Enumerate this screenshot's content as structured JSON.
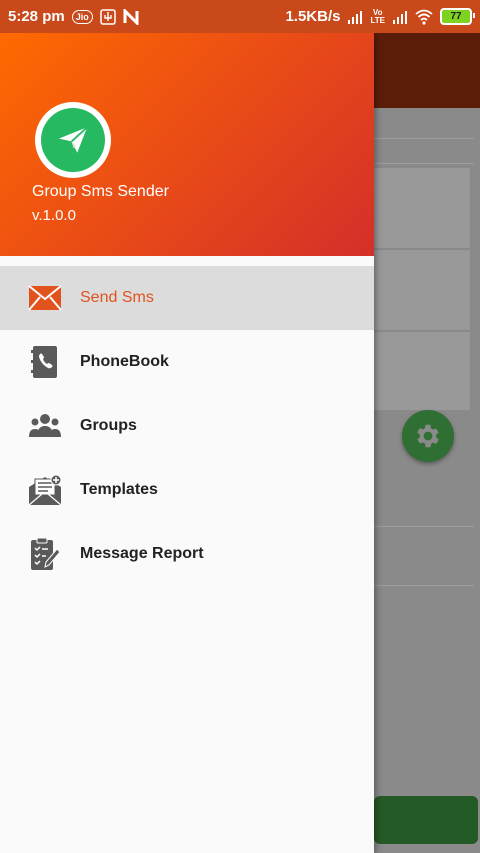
{
  "status_bar": {
    "time": "5:28 pm",
    "carrier_badge": "Jio",
    "speed": "1.5KB/s",
    "volte_top": "Vo",
    "volte_bottom": "LTE",
    "battery": "77"
  },
  "drawer": {
    "app_name": "Group Sms Sender",
    "version": "v.1.0.0",
    "items": [
      {
        "label": "Send Sms",
        "icon": "envelope-icon",
        "active": true
      },
      {
        "label": "PhoneBook",
        "icon": "phonebook-icon",
        "active": false
      },
      {
        "label": "Groups",
        "icon": "groups-icon",
        "active": false
      },
      {
        "label": "Templates",
        "icon": "templates-icon",
        "active": false
      },
      {
        "label": "Message Report",
        "icon": "report-icon",
        "active": false
      }
    ]
  },
  "colors": {
    "accent": "#e2521d",
    "header_start": "#ff6a00",
    "header_end": "#d42f2a",
    "logo_green": "#27b862",
    "fab_green": "#2f6f34"
  }
}
